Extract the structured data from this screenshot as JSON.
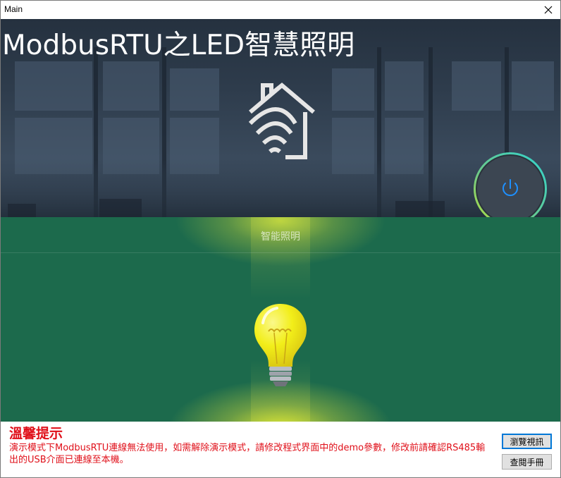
{
  "window": {
    "title": "Main",
    "close_icon": "close-icon"
  },
  "hero": {
    "app_title": "ModbusRTU之LED智慧照明",
    "home_icon": "smart-home-wifi-icon",
    "power_icon": "power-icon",
    "power_ring_colors": [
      "#2fd3d0",
      "#b7e13a"
    ]
  },
  "light_section": {
    "title": "智能照明",
    "bulb_icon": "lightbulb-icon",
    "bulb_color": "#f2ee19",
    "background_color": "#1c6a4c"
  },
  "footer": {
    "warning_title": "溫馨提示",
    "warning_text": "演示模式下ModbusRTU連線無法使用，如需解除演示模式，請修改程式界面中的demo參數，修改前請確認RS485輸出的USB介面已連線至本機。",
    "warning_color": "#e0101a",
    "browse_button": "瀏覽視訊",
    "manual_button": "查閱手冊"
  }
}
